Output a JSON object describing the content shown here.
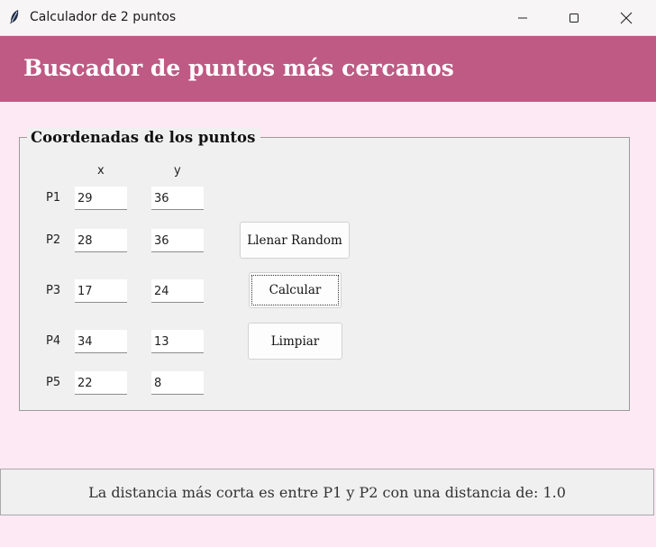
{
  "window": {
    "title": "Calculador de 2 puntos",
    "icons": [
      "feather-icon",
      "minimize-icon",
      "maximize-icon",
      "close-icon"
    ]
  },
  "header": {
    "title": "Buscador de puntos más cercanos",
    "background": "#be5a84"
  },
  "coords_group": {
    "title": "Coordenadas de los puntos",
    "x_header": "x",
    "y_header": "y",
    "points": [
      {
        "label": "P1",
        "x": "29",
        "y": "36"
      },
      {
        "label": "P2",
        "x": "28",
        "y": "36"
      },
      {
        "label": "P3",
        "x": "17",
        "y": "24"
      },
      {
        "label": "P4",
        "x": "34",
        "y": "13"
      },
      {
        "label": "P5",
        "x": "22",
        "y": "8"
      }
    ]
  },
  "buttons": {
    "random": "Llenar Random",
    "calculate": "Calcular",
    "clear": "Limpiar"
  },
  "result": {
    "text": "La distancia más corta es entre P1 y P2 con una distancia de: 1.0"
  },
  "colors": {
    "page_background": "#fde9f4",
    "panel_background": "#f0f0f0"
  }
}
